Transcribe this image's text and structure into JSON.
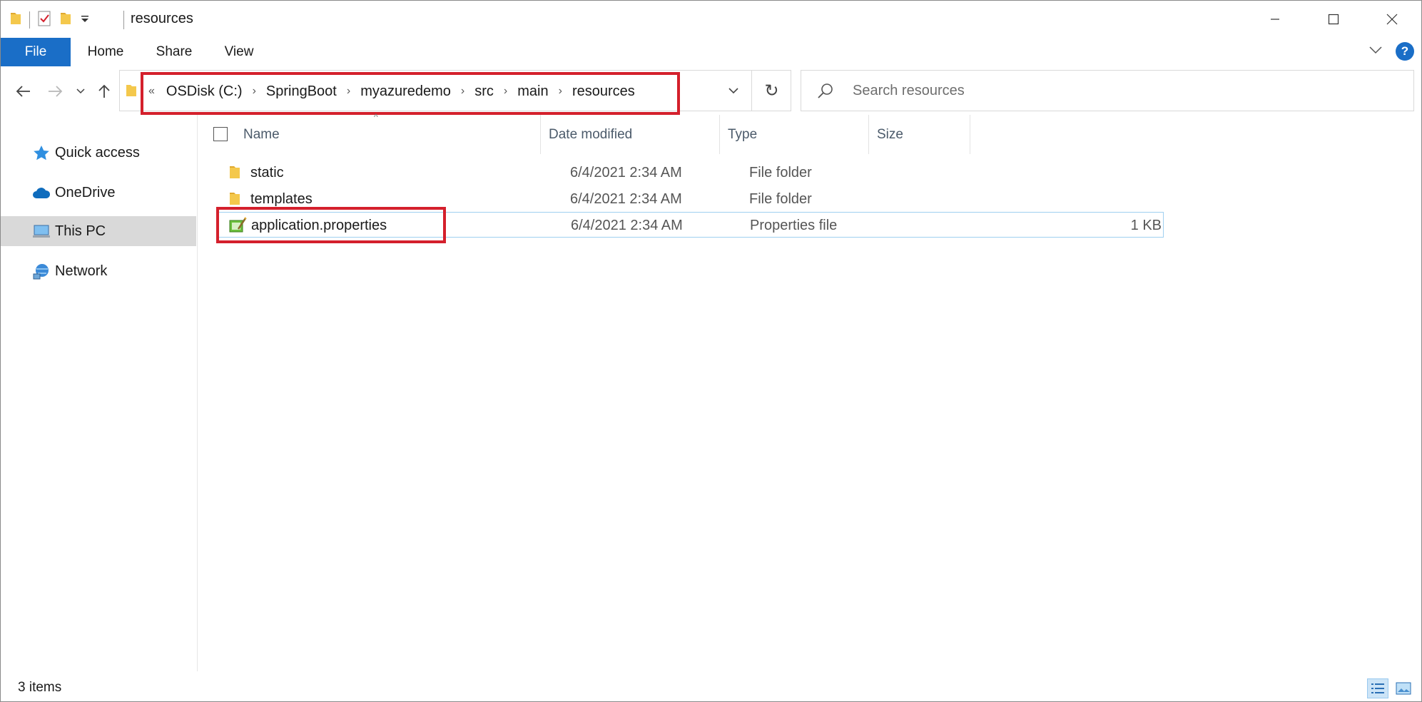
{
  "window": {
    "title": "resources"
  },
  "ribbon": {
    "tabs": [
      "File",
      "Home",
      "Share",
      "View"
    ]
  },
  "address": {
    "overflow": "«",
    "crumbs": [
      "OSDisk (C:)",
      "SpringBoot",
      "myazuredemo",
      "src",
      "main",
      "resources"
    ]
  },
  "search": {
    "placeholder": "Search resources"
  },
  "sidebar": {
    "items": [
      {
        "label": "Quick access",
        "icon": "star-icon"
      },
      {
        "label": "OneDrive",
        "icon": "cloud-icon"
      },
      {
        "label": "This PC",
        "icon": "computer-icon",
        "selected": true
      },
      {
        "label": "Network",
        "icon": "network-icon"
      }
    ]
  },
  "columns": {
    "name": "Name",
    "date": "Date modified",
    "type": "Type",
    "size": "Size"
  },
  "files": [
    {
      "name": "static",
      "date": "6/4/2021 2:34 AM",
      "type": "File folder",
      "size": "",
      "icon": "folder-icon"
    },
    {
      "name": "templates",
      "date": "6/4/2021 2:34 AM",
      "type": "File folder",
      "size": "",
      "icon": "folder-icon"
    },
    {
      "name": "application.properties",
      "date": "6/4/2021 2:34 AM",
      "type": "Properties file",
      "size": "1 KB",
      "icon": "properties-file-icon"
    }
  ],
  "status": {
    "item_count": "3 items"
  },
  "colors": {
    "accent": "#1a6ec7",
    "highlight": "#d4202c",
    "folder": "#f4c84c",
    "selection_bg": "#d9d9d9"
  }
}
